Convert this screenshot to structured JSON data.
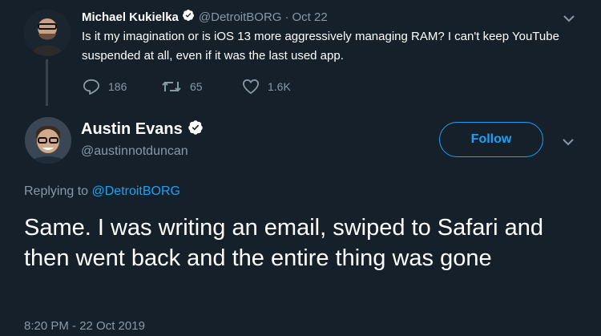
{
  "parent_tweet": {
    "display_name": "Michael Kukielka",
    "handle": "@DetroitBORG",
    "separator": "·",
    "date": "Oct 22",
    "text": "Is it my imagination or is iOS 13 more aggressively managing RAM?  I can't keep YouTube suspended at all, even if it was the last used app.",
    "replies": "186",
    "retweets": "65",
    "likes": "1.6K"
  },
  "main_tweet": {
    "display_name": "Austin Evans",
    "handle": "@austinnotduncan",
    "follow_label": "Follow",
    "replying_prefix": "Replying to",
    "replying_handle": "@DetroitBORG",
    "text": "Same. I was writing an email, swiped to Safari and then went back and the entire thing was gone",
    "timestamp": "8:20 PM - 22 Oct 2019"
  },
  "colors": {
    "background": "#15202b",
    "accent": "#1da1f2",
    "muted": "#8899a6"
  },
  "icons": [
    "chevron-down-icon",
    "verified-badge-icon",
    "reply-icon",
    "retweet-icon",
    "like-icon"
  ]
}
